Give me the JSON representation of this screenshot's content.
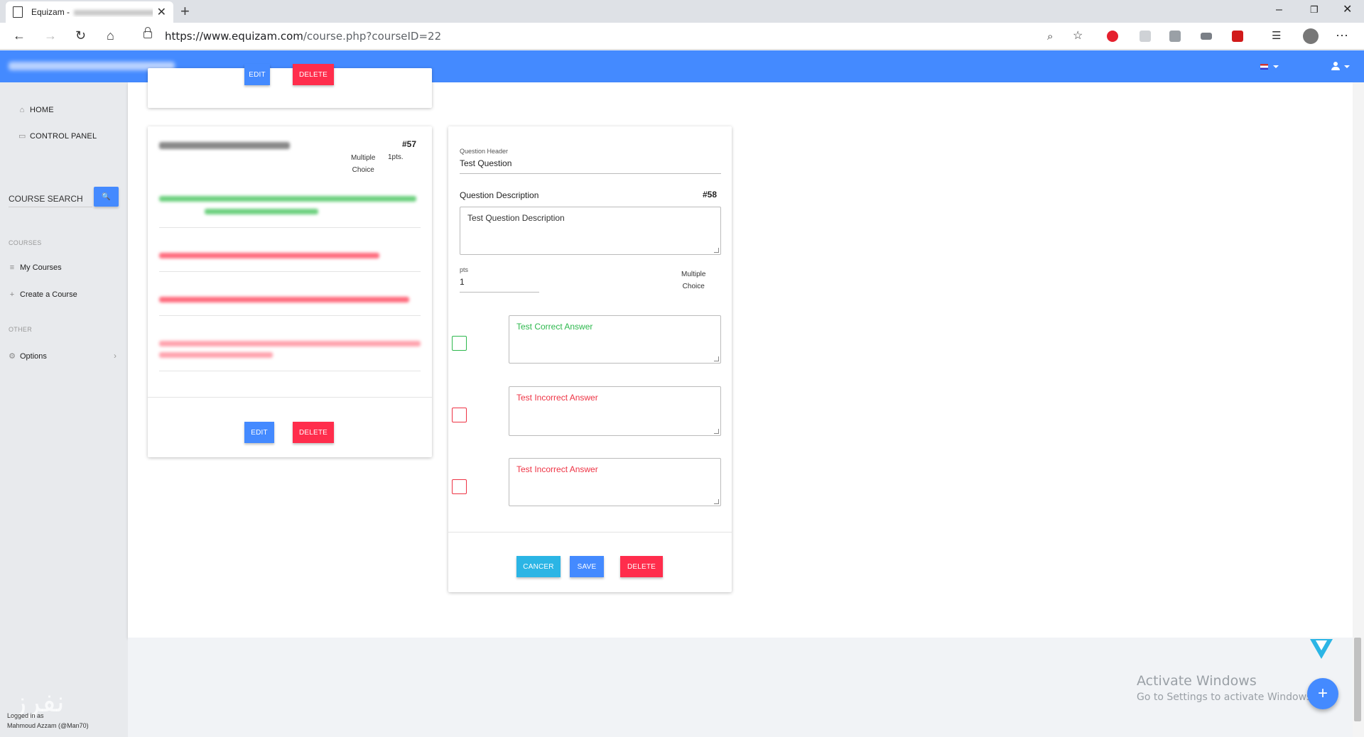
{
  "browser": {
    "tab_title": "Equizam -",
    "url_host": "https://www.equizam.com",
    "url_path": "/course.php?courseID=22"
  },
  "sidebar": {
    "home": "HOME",
    "control_panel": "CONTROL PANEL",
    "course_search": "COURSE SEARCH",
    "courses_section": "COURSES",
    "my_courses": "My Courses",
    "create_course": "Create a Course",
    "other_section": "OTHER",
    "options": "Options",
    "logged_in_label": "Logged in as",
    "logged_in_user": "Mahmoud Azzam (@Man70)"
  },
  "card_top": {
    "edit_label": "EDIT",
    "delete_label": "DELETE"
  },
  "card_57": {
    "number": "#57",
    "type_line1": "Multiple",
    "type_line2": "Choice",
    "points": "1pts.",
    "edit_label": "EDIT",
    "delete_label": "DELETE"
  },
  "editor_58": {
    "header_label": "Question Header",
    "header_value": "Test Question",
    "description_label": "Question Description",
    "number": "#58",
    "description_value": "Test Question Description",
    "pts_label": "pts",
    "pts_value": "1",
    "type_line1": "Multiple",
    "type_line2": "Choice",
    "answers": [
      {
        "text": "Test Correct Answer",
        "correct": true
      },
      {
        "text": "Test Incorrect Answer",
        "correct": false
      },
      {
        "text": "Test Incorrect Answer",
        "correct": false
      }
    ],
    "cancel_label": "CANCER",
    "save_label": "SAVE",
    "delete_label": "DELETE"
  },
  "windows": {
    "activate_title": "Activate Windows",
    "activate_sub": "Go to Settings to activate Windows."
  },
  "colors": {
    "primary": "#448aff",
    "danger": "#ff2d4c",
    "info": "#2bb5e5",
    "correct": "#2db84d",
    "incorrect": "#ee3344"
  }
}
